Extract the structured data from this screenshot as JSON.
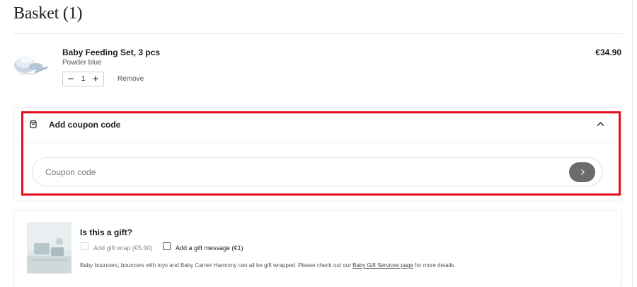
{
  "basket": {
    "title": "Basket (1)"
  },
  "item": {
    "name": "Baby Feeding Set, 3 pcs",
    "variant": "Powder blue",
    "price": "€34.90",
    "quantity": "1",
    "decrease_symbol": "−",
    "increase_symbol": "+",
    "remove_label": "Remove",
    "thumbnail_icon": "feeding-set-product-image"
  },
  "coupon": {
    "title": "Add coupon code",
    "icon": "tag-icon",
    "toggle_icon": "chevron-up-icon",
    "input_placeholder": "Coupon code",
    "input_value": "",
    "submit_icon": "chevron-right-icon"
  },
  "gift": {
    "title": "Is this a gift?",
    "gift_wrap_label": "Add gift wrap (€5.90)",
    "gift_message_label": "Add a gift message (€1)",
    "info_text_before": "Baby bouncers, bouncers with toys and Baby Carrier Harmony can all be gift wrapped. Please check out our",
    "info_link": "Baby Gift Services page",
    "info_text_after": "for more details.",
    "image_icon": "gift-product-image"
  },
  "colors": {
    "highlight": "#e3101b",
    "submit_button": "#6b6b6b",
    "text": "#1d1d1d"
  }
}
